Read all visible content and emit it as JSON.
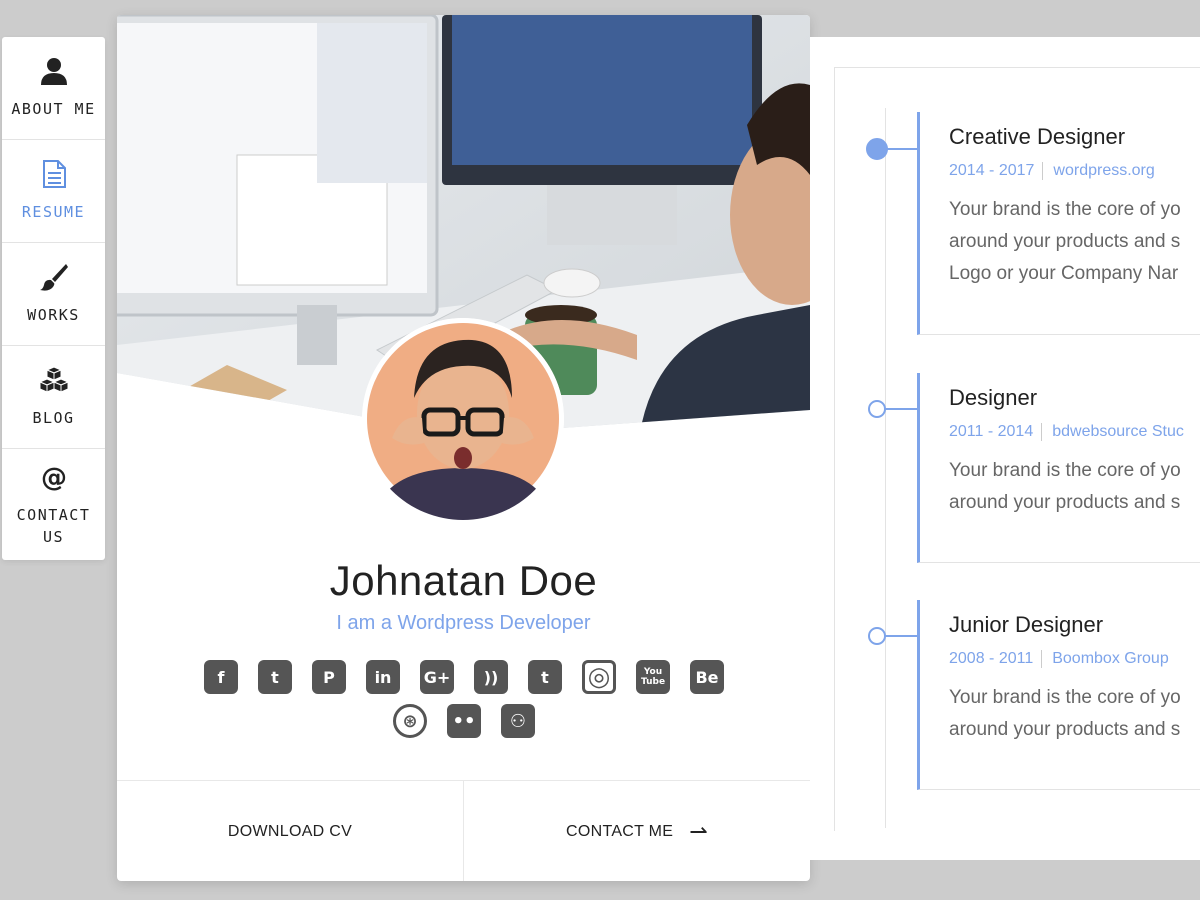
{
  "nav": {
    "items": [
      {
        "label": "ABOUT ME",
        "icon": "user-icon",
        "active": false
      },
      {
        "label": "RESUME",
        "icon": "document-icon",
        "active": true
      },
      {
        "label": "WORKS",
        "icon": "paint-brush-icon",
        "active": false
      },
      {
        "label": "BLOG",
        "icon": "cubes-icon",
        "active": false
      },
      {
        "label": "CONTACT US",
        "icon": "at-sign-icon",
        "active": false
      }
    ]
  },
  "profile": {
    "name": "Johnatan Doe",
    "role": "I am a Wordpress Developer",
    "socials": [
      {
        "icon": "facebook-icon",
        "glyph": "f"
      },
      {
        "icon": "twitter-icon",
        "glyph": "t"
      },
      {
        "icon": "pinterest-icon",
        "glyph": "P"
      },
      {
        "icon": "linkedin-icon",
        "glyph": "in"
      },
      {
        "icon": "google-plus-icon",
        "glyph": "G+"
      },
      {
        "icon": "rss-icon",
        "glyph": "))"
      },
      {
        "icon": "tumblr-icon",
        "glyph": "t"
      },
      {
        "icon": "instagram-icon",
        "glyph": "◎"
      },
      {
        "icon": "youtube-icon",
        "glyph": "You Tube"
      },
      {
        "icon": "behance-icon",
        "glyph": "Be"
      },
      {
        "icon": "dribbble-icon",
        "glyph": "⊛"
      },
      {
        "icon": "flickr-icon",
        "glyph": "••"
      },
      {
        "icon": "github-icon",
        "glyph": "⚇"
      }
    ],
    "download_cv": "DOWNLOAD CV",
    "contact_me": "CONTACT ME"
  },
  "resume": {
    "entries": [
      {
        "title": "Creative Designer",
        "years": "2014 - 2017",
        "company": "wordpress.org",
        "desc": [
          "Your brand is the core of yo",
          "around your products and s",
          "Logo or your Company Nar"
        ],
        "current": true
      },
      {
        "title": "Designer",
        "years": "2011 - 2014",
        "company": "bdwebsource Stuc",
        "desc": [
          "Your brand is the core of yo",
          "around your products and s"
        ],
        "current": false
      },
      {
        "title": "Junior Designer",
        "years": "2008 - 2011",
        "company": "Boombox Group",
        "desc": [
          "Your brand is the core of yo",
          "around your products and s"
        ],
        "current": false
      }
    ]
  },
  "colors": {
    "accent": "#7ea4ea",
    "page_bg": "#cccccc",
    "icon_dark": "#555555"
  }
}
